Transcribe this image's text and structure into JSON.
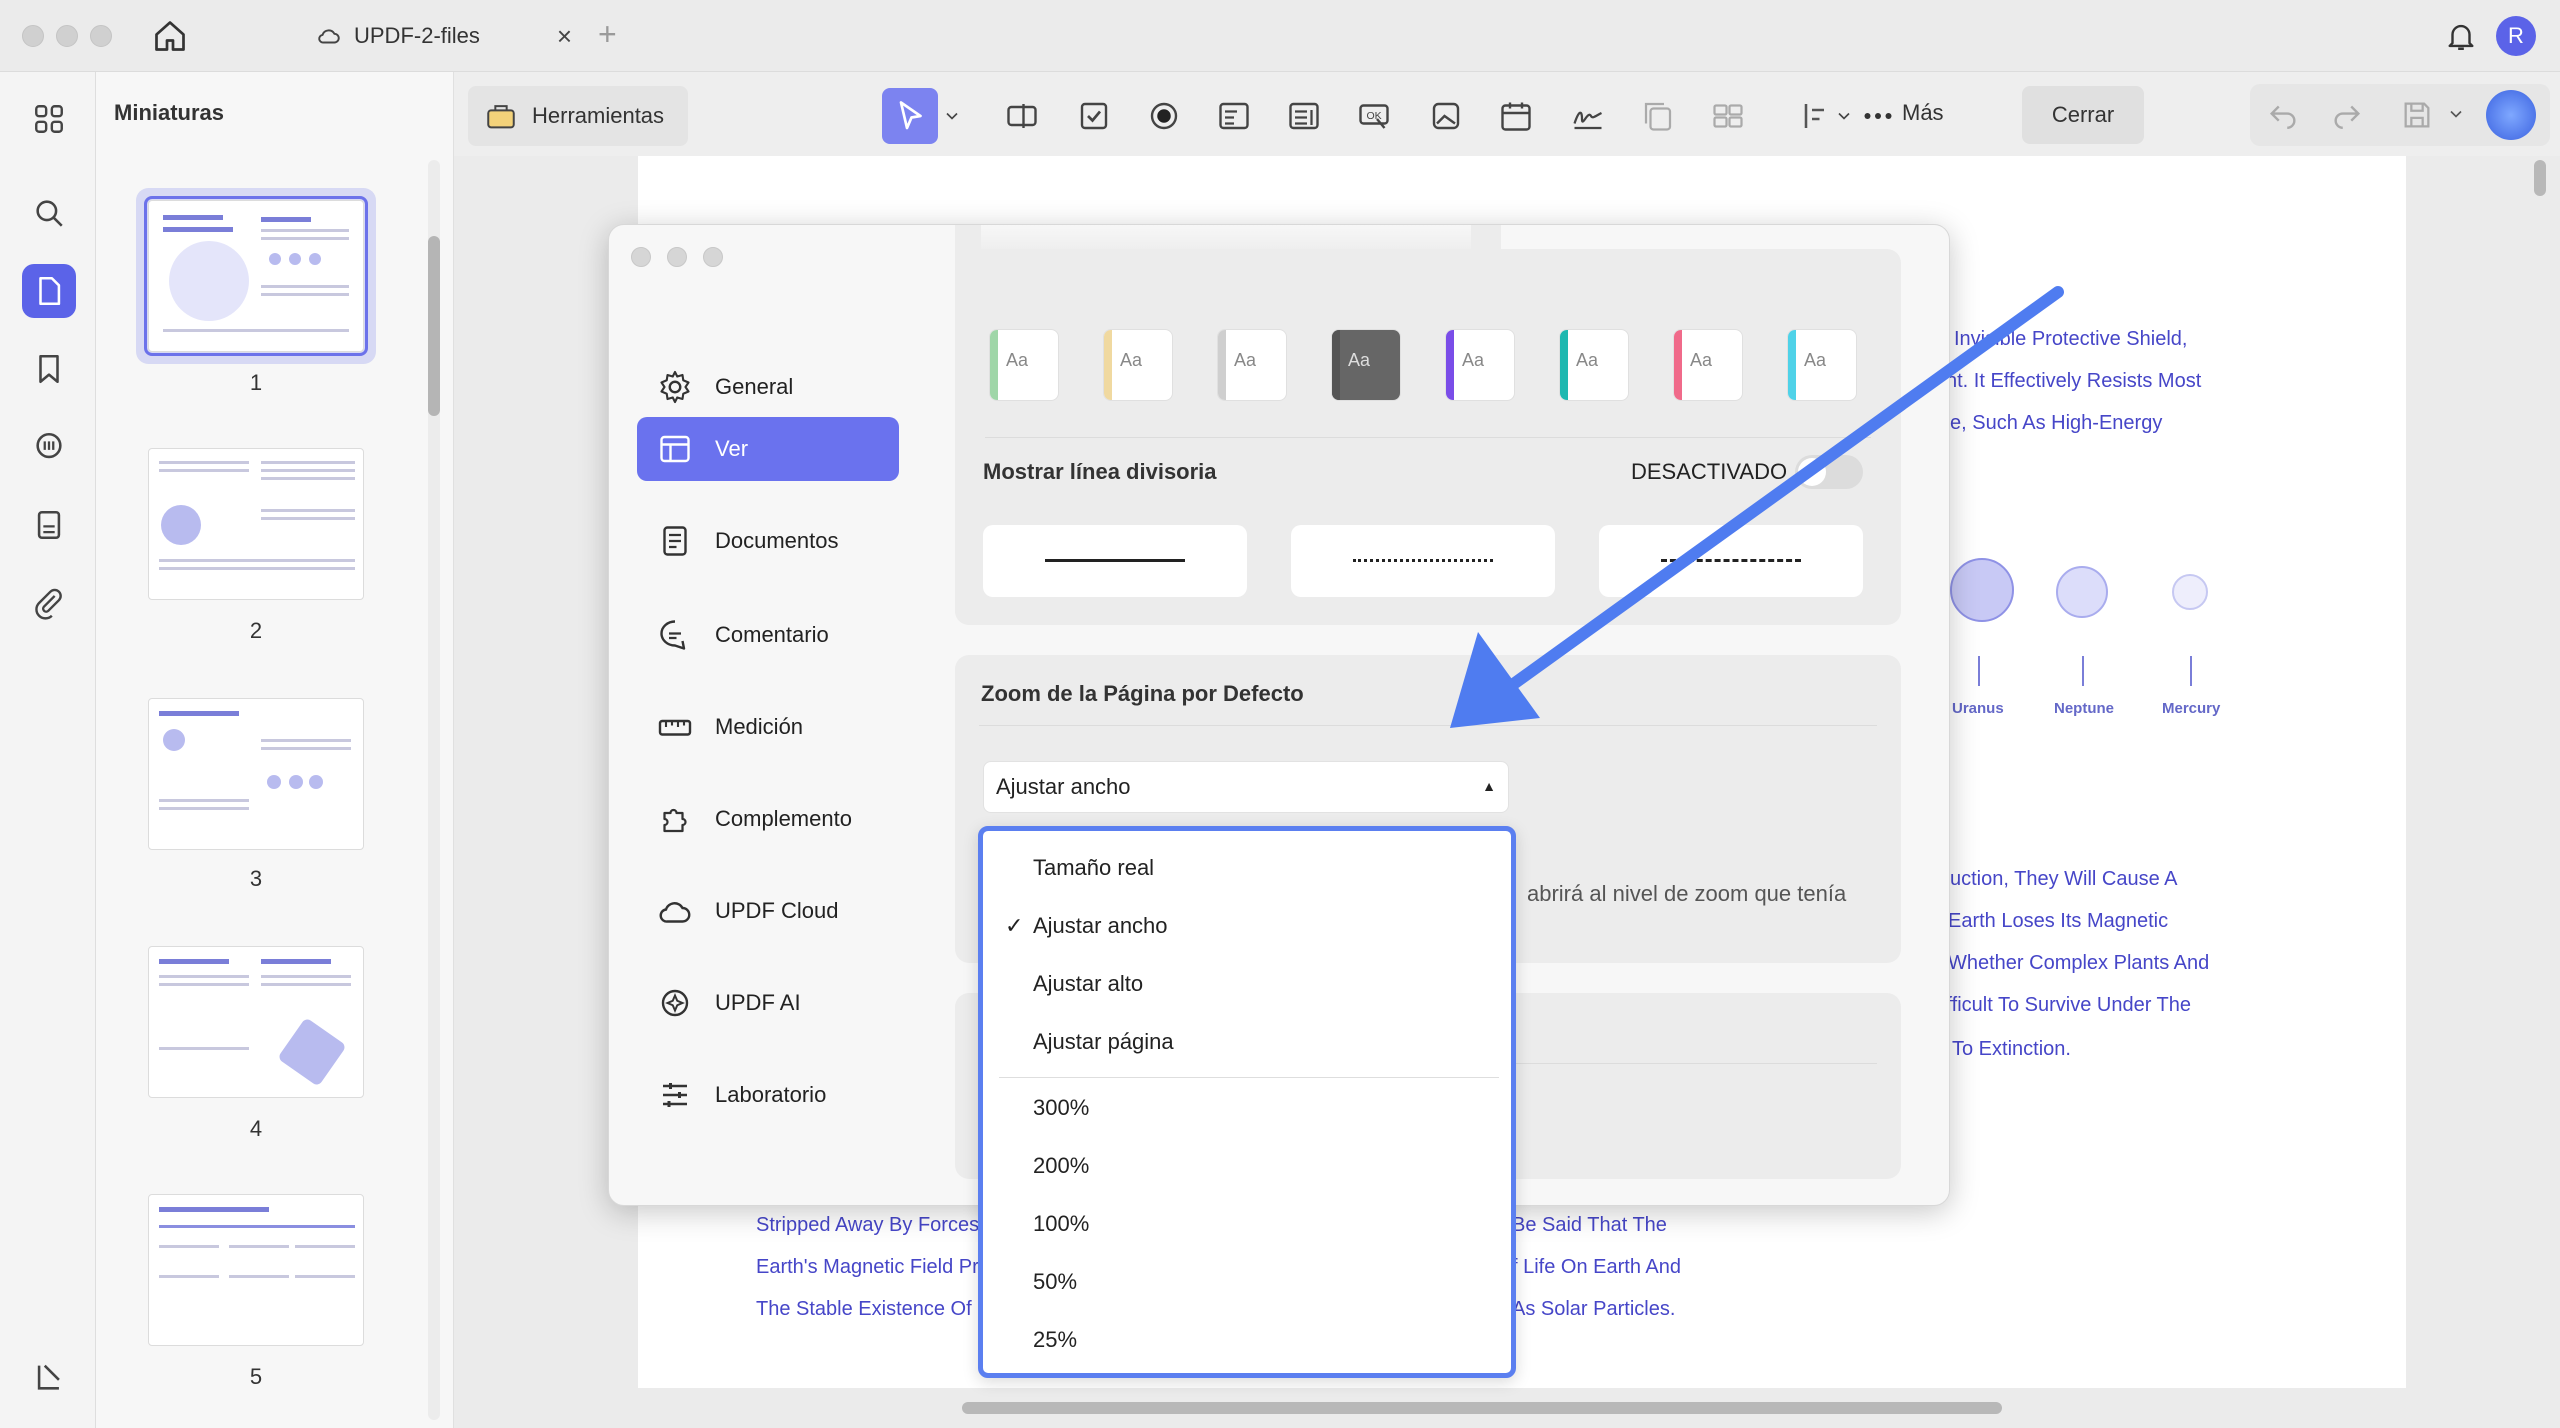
{
  "window": {
    "tab_title": "UPDF-2-files",
    "avatar_initial": "R"
  },
  "sidebar_panel": {
    "title": "Miniaturas",
    "pages": [
      "1",
      "2",
      "3",
      "4",
      "5"
    ]
  },
  "toolbar": {
    "tools_label": "Herramientas",
    "more_label": "Más",
    "close_label": "Cerrar"
  },
  "preferences": {
    "nav": [
      {
        "label": "General",
        "icon": "gear-icon"
      },
      {
        "label": "Ver",
        "icon": "layout-icon"
      },
      {
        "label": "Documentos",
        "icon": "document-icon"
      },
      {
        "label": "Comentario",
        "icon": "comment-icon"
      },
      {
        "label": "Medición",
        "icon": "ruler-icon"
      },
      {
        "label": "Complemento",
        "icon": "puzzle-icon"
      },
      {
        "label": "UPDF Cloud",
        "icon": "cloud-icon"
      },
      {
        "label": "UPDF AI",
        "icon": "ai-icon"
      },
      {
        "label": "Laboratorio",
        "icon": "sliders-icon"
      }
    ],
    "active_nav": "Ver",
    "divider_label": "Mostrar línea divisoria",
    "divider_state": "DESACTIVADO",
    "zoom_label": "Zoom de la Página por Defecto",
    "zoom_selected": "Ajustar ancho",
    "help_text_partial": "abrirá al nivel de zoom que tenía",
    "theme_colors": [
      "#9fd6a8",
      "#f0d9a0",
      "#cfcfcf",
      "#555555",
      "#7a4de8",
      "#1eb8b0",
      "#f06a8a",
      "#4fd2e8"
    ]
  },
  "zoom_dropdown": {
    "options": [
      "Tamaño real",
      "Ajustar ancho",
      "Ajustar alto",
      "Ajustar página"
    ],
    "checked": "Ajustar ancho",
    "percent_options": [
      "300%",
      "200%",
      "100%",
      "50%",
      "25%"
    ]
  },
  "document": {
    "right_lines": [
      "Invisible Protective Shield,",
      "nt. It Effectively Resists Most",
      "e, Such As High-Energy"
    ],
    "planets": [
      "Uranus",
      "Neptune",
      "Mercury"
    ],
    "right_lines_2": [
      "uction, They Will Cause A",
      "Earth Loses Its Magnetic",
      "Whether Complex Plants And",
      "ifficult To Survive Under The",
      "To Extinction."
    ],
    "bottom_left": [
      "Stripped Away By Forces",
      "Earth's Magnetic Field Pr",
      "The Stable Existence Of"
    ],
    "bottom_right": [
      "Be Said That The",
      "f Life On Earth And",
      "As Solar Particles."
    ]
  },
  "colors": {
    "accent": "#5b63e8",
    "dropdown_border": "#5b7ff0",
    "doc_text": "#4646c8",
    "arrow": "#4f7cf0"
  }
}
